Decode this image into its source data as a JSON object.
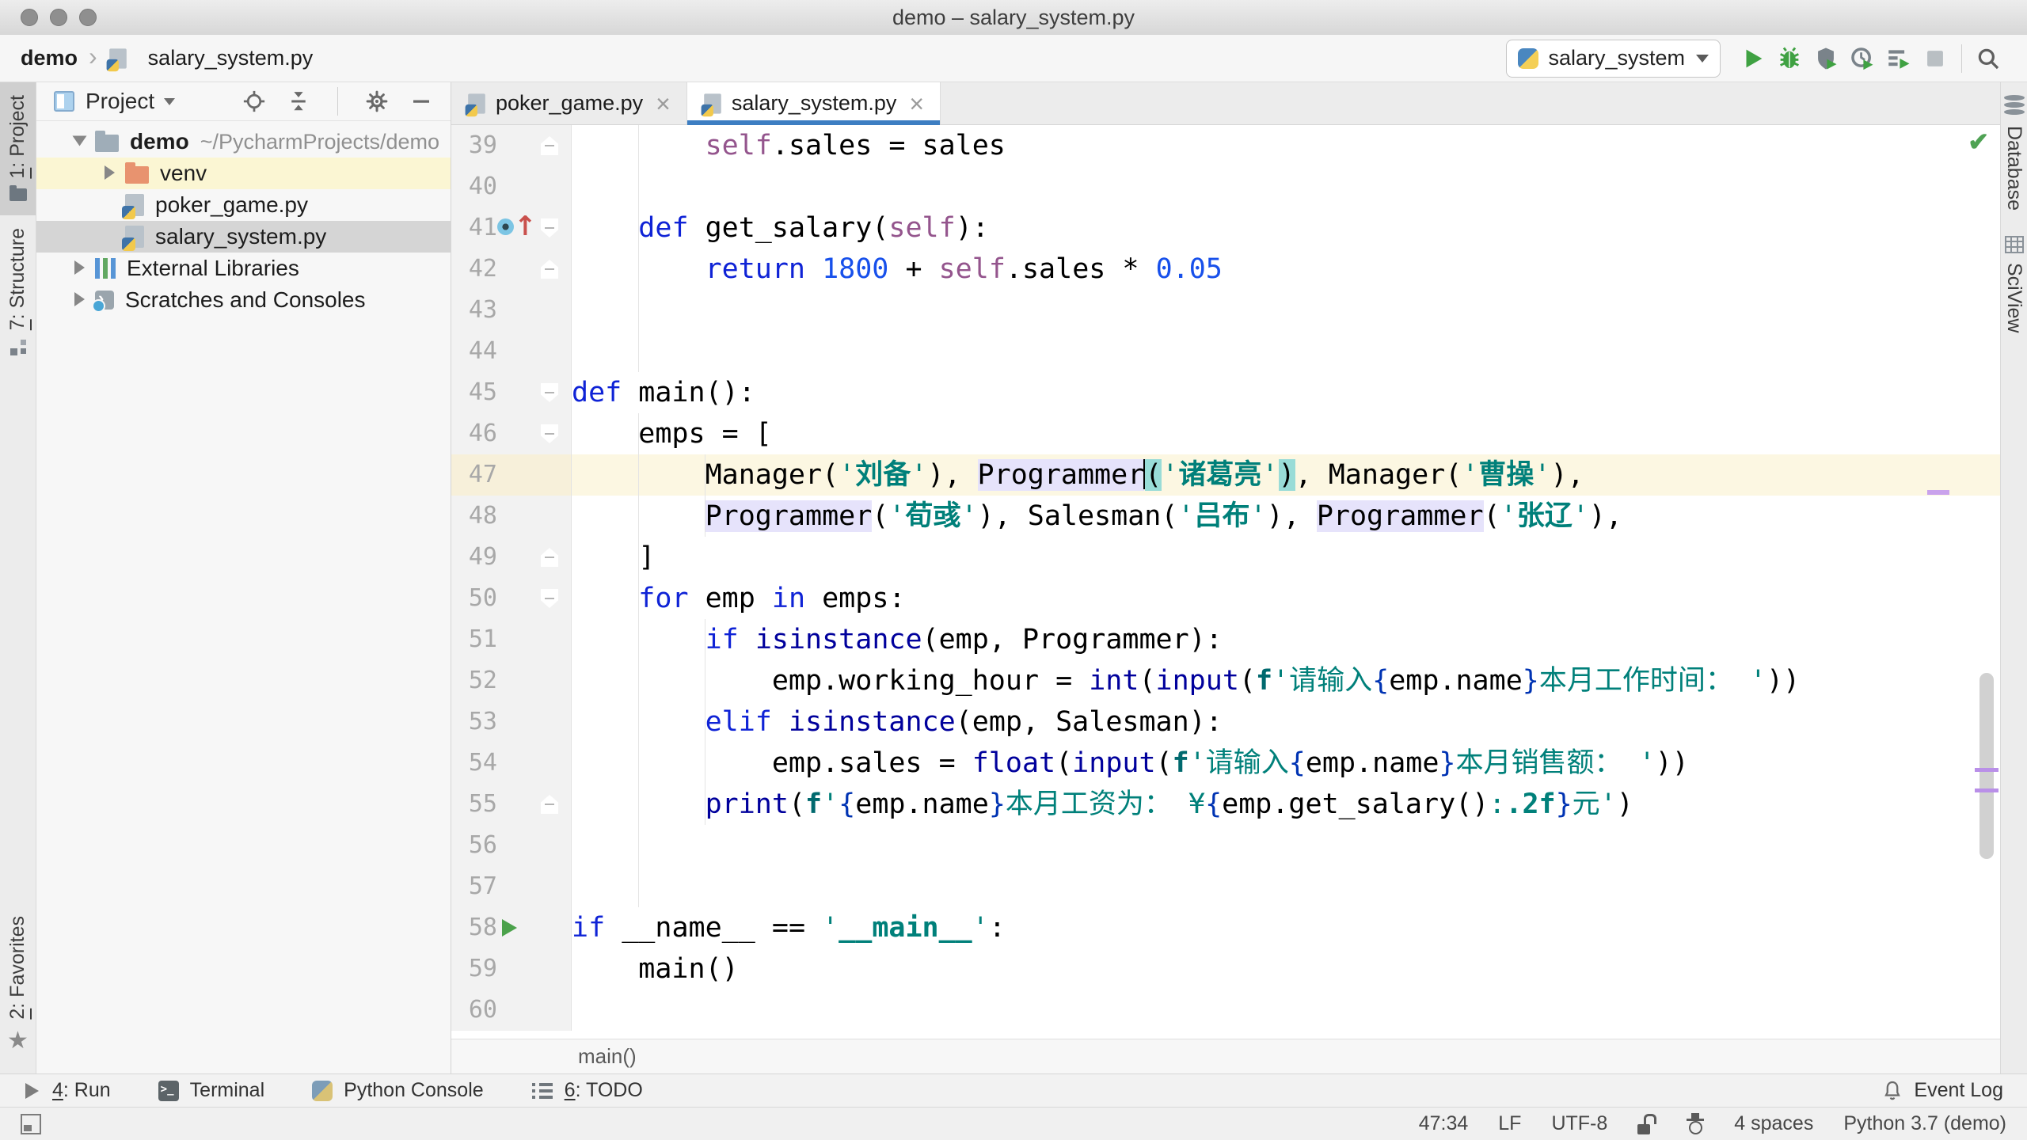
{
  "window": {
    "title": "demo – salary_system.py"
  },
  "navbar": {
    "project": "demo",
    "file": "salary_system.py",
    "run_config": "salary_system"
  },
  "toolbar": {
    "buttons": [
      {
        "name": "run",
        "icon": "run"
      },
      {
        "name": "debug",
        "icon": "debug"
      },
      {
        "name": "run-with-coverage",
        "icon": "coverage"
      },
      {
        "name": "profile",
        "icon": "profiler"
      },
      {
        "name": "concurrency-diagram",
        "icon": "concurrency"
      },
      {
        "name": "stop",
        "icon": "stop"
      },
      {
        "name": "divider"
      },
      {
        "name": "search-everywhere",
        "icon": "search"
      }
    ]
  },
  "left_stripe": {
    "items": [
      {
        "id": "project",
        "icon": "project",
        "mnemonic": "1",
        "rest": ": Project",
        "active": true
      },
      {
        "id": "structure",
        "icon": "structure",
        "mnemonic": "7",
        "rest": ": Structure"
      },
      {
        "id": "favorites",
        "icon": "star",
        "mnemonic": "2",
        "rest": ": Favorites",
        "bottom": true
      }
    ]
  },
  "right_stripe": {
    "items": [
      {
        "id": "database",
        "icon": "database",
        "label": "Database"
      },
      {
        "id": "sciview",
        "icon": "grid",
        "label": "SciView"
      }
    ]
  },
  "project": {
    "header": "Project",
    "header_icons": [
      {
        "name": "locate",
        "icon": "locate"
      },
      {
        "name": "collapse-all",
        "icon": "collapse"
      },
      {
        "name": "divider"
      },
      {
        "name": "settings",
        "icon": "gear"
      },
      {
        "name": "hide",
        "icon": "hide"
      }
    ],
    "items": [
      {
        "id": "demo",
        "label": "demo",
        "suffix": "~/PycharmProjects/demo",
        "icon": "folder-blue",
        "arrow": "down",
        "indent": 0,
        "bold": true
      },
      {
        "id": "venv",
        "label": "venv",
        "icon": "folder-orange",
        "arrow": "right",
        "indent": 1,
        "state": "hover"
      },
      {
        "id": "poker-game",
        "label": "poker_game.py",
        "icon": "python-file",
        "indent": 1
      },
      {
        "id": "salary-system",
        "label": "salary_system.py",
        "icon": "python-file",
        "indent": 1,
        "state": "selected"
      },
      {
        "id": "external-libraries",
        "label": "External Libraries",
        "icon": "libraries",
        "arrow": "right",
        "indent": 0
      },
      {
        "id": "scratches",
        "label": "Scratches and Consoles",
        "icon": "scratches",
        "arrow": "right",
        "indent": 0
      }
    ]
  },
  "editor": {
    "tabs": [
      {
        "label": "poker_game.py",
        "active": false
      },
      {
        "label": "salary_system.py",
        "active": true
      }
    ],
    "breadcrumb": "main()",
    "lines": [
      {
        "num": 39,
        "fold": "up",
        "seg": [
          {
            "c": "d",
            "t": "        "
          },
          {
            "c": "p",
            "t": "self"
          },
          {
            "c": "d",
            "t": ".sales = sales"
          }
        ]
      },
      {
        "num": 40,
        "seg": []
      },
      {
        "num": 41,
        "icon": "override",
        "fold": "down",
        "seg": [
          {
            "c": "d",
            "t": "    "
          },
          {
            "c": "k",
            "t": "def"
          },
          {
            "c": "d",
            "t": " get_salary("
          },
          {
            "c": "p",
            "t": "self"
          },
          {
            "c": "d",
            "t": "):"
          }
        ]
      },
      {
        "num": 42,
        "fold": "up",
        "seg": [
          {
            "c": "d",
            "t": "        "
          },
          {
            "c": "k",
            "t": "return"
          },
          {
            "c": "d",
            "t": " "
          },
          {
            "c": "n",
            "t": "1800"
          },
          {
            "c": "d",
            "t": " + "
          },
          {
            "c": "p",
            "t": "self"
          },
          {
            "c": "d",
            "t": ".sales * "
          },
          {
            "c": "n",
            "t": "0.05"
          }
        ]
      },
      {
        "num": 43,
        "seg": []
      },
      {
        "num": 44,
        "seg": []
      },
      {
        "num": 45,
        "fold": "down",
        "seg": [
          {
            "c": "k",
            "t": "def"
          },
          {
            "c": "d",
            "t": " main():"
          }
        ]
      },
      {
        "num": 46,
        "fold": "down",
        "seg": [
          {
            "c": "d",
            "t": "    emps = ["
          }
        ]
      },
      {
        "num": 47,
        "current": true,
        "seg": [
          {
            "c": "d",
            "t": "        Manager("
          },
          {
            "c": "s",
            "t": "'"
          },
          {
            "c": "sb",
            "t": "刘备"
          },
          {
            "c": "s",
            "t": "'"
          },
          {
            "c": "d",
            "t": "), "
          },
          {
            "c": "d hi",
            "t": "Programmer"
          },
          {
            "caret": true
          },
          {
            "c": "d hp",
            "t": "("
          },
          {
            "c": "s",
            "t": "'"
          },
          {
            "c": "sb",
            "t": "诸葛亮"
          },
          {
            "c": "s",
            "t": "'"
          },
          {
            "c": "d hp",
            "t": ")"
          },
          {
            "c": "d",
            "t": ", Manager("
          },
          {
            "c": "s",
            "t": "'"
          },
          {
            "c": "sb",
            "t": "曹操"
          },
          {
            "c": "s",
            "t": "'"
          },
          {
            "c": "d",
            "t": "),"
          }
        ]
      },
      {
        "num": 48,
        "seg": [
          {
            "c": "d",
            "t": "        "
          },
          {
            "c": "d hi",
            "t": "Programmer"
          },
          {
            "c": "d",
            "t": "("
          },
          {
            "c": "s",
            "t": "'"
          },
          {
            "c": "sb",
            "t": "荀彧"
          },
          {
            "c": "s",
            "t": "'"
          },
          {
            "c": "d",
            "t": "), Salesman("
          },
          {
            "c": "s",
            "t": "'"
          },
          {
            "c": "sb",
            "t": "吕布"
          },
          {
            "c": "s",
            "t": "'"
          },
          {
            "c": "d",
            "t": "), "
          },
          {
            "c": "d hi",
            "t": "Programmer"
          },
          {
            "c": "d",
            "t": "("
          },
          {
            "c": "s",
            "t": "'"
          },
          {
            "c": "sb",
            "t": "张辽"
          },
          {
            "c": "s",
            "t": "'"
          },
          {
            "c": "d",
            "t": "),"
          }
        ]
      },
      {
        "num": 49,
        "fold": "up",
        "seg": [
          {
            "c": "d",
            "t": "    ]"
          }
        ]
      },
      {
        "num": 50,
        "fold": "down",
        "seg": [
          {
            "c": "d",
            "t": "    "
          },
          {
            "c": "k",
            "t": "for"
          },
          {
            "c": "d",
            "t": " emp "
          },
          {
            "c": "k",
            "t": "in"
          },
          {
            "c": "d",
            "t": " emps:"
          }
        ]
      },
      {
        "num": 51,
        "seg": [
          {
            "c": "d",
            "t": "        "
          },
          {
            "c": "k",
            "t": "if"
          },
          {
            "c": "d",
            "t": " "
          },
          {
            "c": "b",
            "t": "isinstance"
          },
          {
            "c": "d",
            "t": "(emp, Programmer):"
          }
        ]
      },
      {
        "num": 52,
        "seg": [
          {
            "c": "d",
            "t": "            emp.working_hour = "
          },
          {
            "c": "b",
            "t": "int"
          },
          {
            "c": "d",
            "t": "("
          },
          {
            "c": "b",
            "t": "input"
          },
          {
            "c": "d",
            "t": "("
          },
          {
            "c": "f",
            "t": "f"
          },
          {
            "c": "s",
            "t": "'请输入"
          },
          {
            "c": "br",
            "t": "{"
          },
          {
            "c": "d",
            "t": "emp.name"
          },
          {
            "c": "br",
            "t": "}"
          },
          {
            "c": "s",
            "t": "本月工作时间： '"
          },
          {
            "c": "d",
            "t": "))"
          }
        ]
      },
      {
        "num": 53,
        "seg": [
          {
            "c": "d",
            "t": "        "
          },
          {
            "c": "k",
            "t": "elif"
          },
          {
            "c": "d",
            "t": " "
          },
          {
            "c": "b",
            "t": "isinstance"
          },
          {
            "c": "d",
            "t": "(emp, Salesman):"
          }
        ]
      },
      {
        "num": 54,
        "seg": [
          {
            "c": "d",
            "t": "            emp.sales = "
          },
          {
            "c": "b",
            "t": "float"
          },
          {
            "c": "d",
            "t": "("
          },
          {
            "c": "b",
            "t": "input"
          },
          {
            "c": "d",
            "t": "("
          },
          {
            "c": "f",
            "t": "f"
          },
          {
            "c": "s",
            "t": "'请输入"
          },
          {
            "c": "br",
            "t": "{"
          },
          {
            "c": "d",
            "t": "emp.name"
          },
          {
            "c": "br",
            "t": "}"
          },
          {
            "c": "s",
            "t": "本月销售额： '"
          },
          {
            "c": "d",
            "t": "))"
          }
        ]
      },
      {
        "num": 55,
        "fold": "up",
        "seg": [
          {
            "c": "d",
            "t": "        "
          },
          {
            "c": "b",
            "t": "print"
          },
          {
            "c": "d",
            "t": "("
          },
          {
            "c": "f",
            "t": "f"
          },
          {
            "c": "s",
            "t": "'"
          },
          {
            "c": "br",
            "t": "{"
          },
          {
            "c": "d",
            "t": "emp.name"
          },
          {
            "c": "br",
            "t": "}"
          },
          {
            "c": "s",
            "t": "本月工资为： ¥"
          },
          {
            "c": "br",
            "t": "{"
          },
          {
            "c": "d",
            "t": "emp.get_salary()"
          },
          {
            "c": "s",
            "t": ":"
          },
          {
            "c": "sb",
            "t": ".2f"
          },
          {
            "c": "br",
            "t": "}"
          },
          {
            "c": "s",
            "t": "元'"
          },
          {
            "c": "d",
            "t": ")"
          }
        ]
      },
      {
        "num": 56,
        "seg": []
      },
      {
        "num": 57,
        "seg": []
      },
      {
        "num": 58,
        "icon": "run",
        "seg": [
          {
            "c": "k",
            "t": "if"
          },
          {
            "c": "d",
            "t": " __name__ == "
          },
          {
            "c": "s",
            "t": "'"
          },
          {
            "c": "sb",
            "t": "__main__"
          },
          {
            "c": "s",
            "t": "'"
          },
          {
            "c": "d",
            "t": ":"
          }
        ]
      },
      {
        "num": 59,
        "seg": [
          {
            "c": "d",
            "t": "    main()"
          }
        ]
      },
      {
        "num": 60,
        "seg": []
      }
    ]
  },
  "bottom_bar": {
    "left": [
      {
        "id": "run",
        "icon": "run-arrow",
        "mnemonic": "4",
        "rest": ": Run"
      },
      {
        "id": "terminal",
        "icon": "terminal",
        "mnemonic": "",
        "rest": "Terminal"
      },
      {
        "id": "python-console",
        "icon": "python-console",
        "mnemonic": "",
        "rest": "Python Console"
      },
      {
        "id": "todo",
        "icon": "todo",
        "mnemonic": "6",
        "rest": ": TODO"
      }
    ],
    "event_log": {
      "label": "Event Log"
    }
  },
  "statusbar": {
    "items": [
      {
        "name": "caret-position",
        "text": "47:34"
      },
      {
        "name": "line-separator",
        "text": "LF"
      },
      {
        "name": "file-encoding",
        "text": "UTF-8"
      },
      {
        "name": "readonly-toggle",
        "icon": "unlock"
      },
      {
        "name": "inspections-widget",
        "icon": "hector"
      },
      {
        "name": "indent-style",
        "text": "4 spaces"
      },
      {
        "name": "python-interpreter",
        "text": "Python 3.7 (demo)"
      }
    ]
  },
  "colors": {
    "active_tab_underline": "#3d7ec2",
    "keyword": "#0f23d6",
    "builtin": "#00009c",
    "number": "#1750eb",
    "string": "#00807a",
    "self_param": "#94558d",
    "current_line": "#fcf7e2",
    "identifier_highlight": "#e6e3fb",
    "paren_match": "#99dcd7",
    "run_green": "#3fa142"
  }
}
